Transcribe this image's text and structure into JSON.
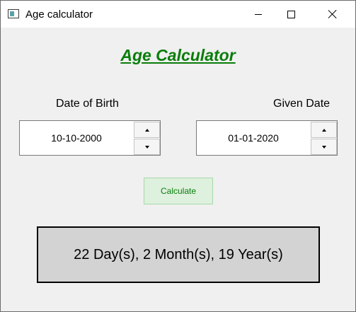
{
  "window": {
    "title": "Age calculator"
  },
  "heading": "Age Calculator",
  "fields": {
    "dob_label": "Date of Birth",
    "dob_value": "10-10-2000",
    "given_label": "Given Date",
    "given_value": "01-01-2020"
  },
  "calculate_label": "Calculate",
  "result_text": "22 Day(s), 2 Month(s), 19 Year(s)",
  "colors": {
    "heading": "#0a7d0a",
    "button_bg": "#def0de",
    "result_bg": "#d3d3d3"
  },
  "icons": [
    "app-window-icon",
    "minimize-icon",
    "maximize-icon",
    "close-icon",
    "chevron-up-icon",
    "chevron-down-icon"
  ]
}
